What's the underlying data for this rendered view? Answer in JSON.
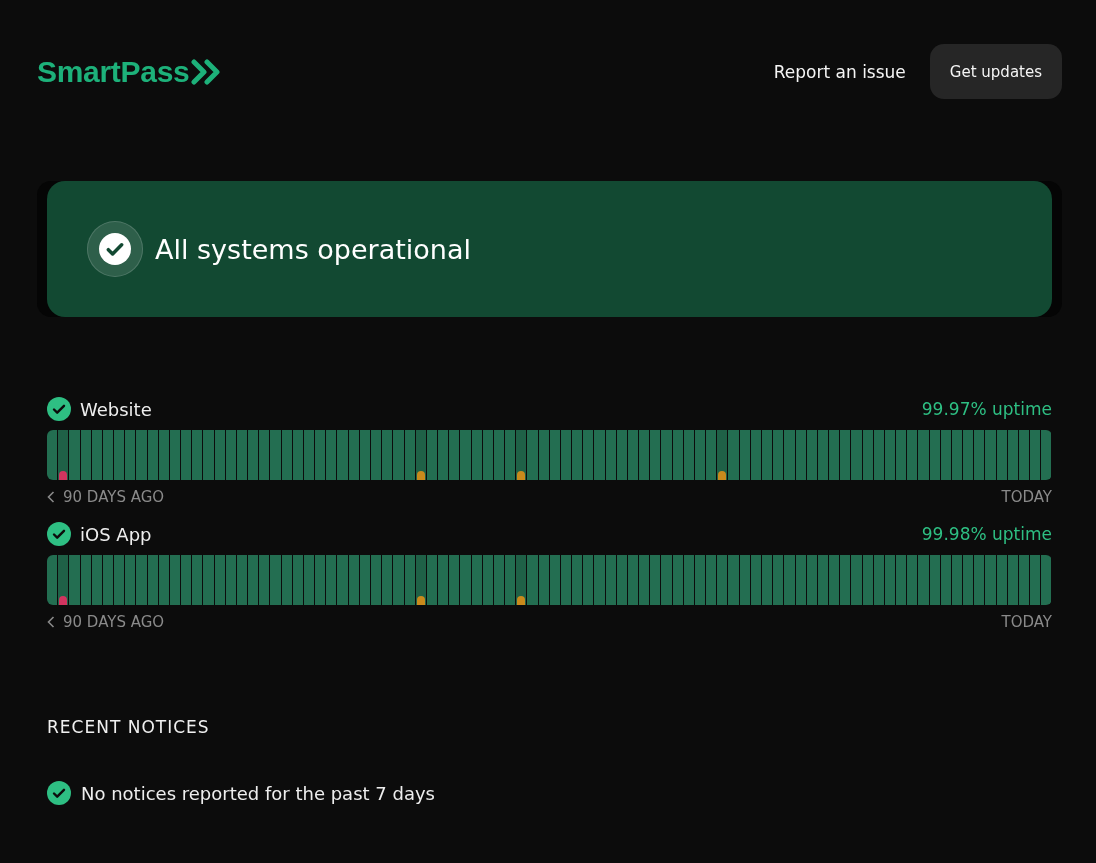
{
  "header": {
    "logo": "SmartPass",
    "links": [
      {
        "label": "Report an issue",
        "kind": "link"
      },
      {
        "label": "Get updates",
        "kind": "button"
      }
    ]
  },
  "banner": {
    "title": "All systems operational",
    "operational": true
  },
  "services": [
    {
      "name": "Website",
      "operational": true,
      "uptime": "99.97% uptime",
      "start_label": "90 DAYS AGO",
      "end_label": "TODAY",
      "days": [
        {
          "kind": "ok"
        },
        {
          "kind": "major"
        },
        {
          "kind": "ok"
        },
        {
          "kind": "ok"
        },
        {
          "kind": "ok"
        },
        {
          "kind": "ok"
        },
        {
          "kind": "ok"
        },
        {
          "kind": "ok"
        },
        {
          "kind": "ok"
        },
        {
          "kind": "ok"
        },
        {
          "kind": "ok"
        },
        {
          "kind": "ok"
        },
        {
          "kind": "ok"
        },
        {
          "kind": "ok"
        },
        {
          "kind": "ok"
        },
        {
          "kind": "ok"
        },
        {
          "kind": "ok"
        },
        {
          "kind": "ok"
        },
        {
          "kind": "ok"
        },
        {
          "kind": "ok"
        },
        {
          "kind": "ok"
        },
        {
          "kind": "ok"
        },
        {
          "kind": "ok"
        },
        {
          "kind": "ok"
        },
        {
          "kind": "ok"
        },
        {
          "kind": "ok"
        },
        {
          "kind": "ok"
        },
        {
          "kind": "ok"
        },
        {
          "kind": "ok"
        },
        {
          "kind": "ok"
        },
        {
          "kind": "ok"
        },
        {
          "kind": "ok"
        },
        {
          "kind": "ok"
        },
        {
          "kind": "minor"
        },
        {
          "kind": "ok"
        },
        {
          "kind": "ok"
        },
        {
          "kind": "ok"
        },
        {
          "kind": "ok"
        },
        {
          "kind": "ok"
        },
        {
          "kind": "ok"
        },
        {
          "kind": "ok"
        },
        {
          "kind": "ok"
        },
        {
          "kind": "minor"
        },
        {
          "kind": "ok"
        },
        {
          "kind": "ok"
        },
        {
          "kind": "ok"
        },
        {
          "kind": "ok"
        },
        {
          "kind": "ok"
        },
        {
          "kind": "ok"
        },
        {
          "kind": "ok"
        },
        {
          "kind": "ok"
        },
        {
          "kind": "ok"
        },
        {
          "kind": "ok"
        },
        {
          "kind": "ok"
        },
        {
          "kind": "ok"
        },
        {
          "kind": "ok"
        },
        {
          "kind": "ok"
        },
        {
          "kind": "ok"
        },
        {
          "kind": "ok"
        },
        {
          "kind": "ok"
        },
        {
          "kind": "minor"
        },
        {
          "kind": "ok"
        },
        {
          "kind": "ok"
        },
        {
          "kind": "ok"
        },
        {
          "kind": "ok"
        },
        {
          "kind": "ok"
        },
        {
          "kind": "ok"
        },
        {
          "kind": "ok"
        },
        {
          "kind": "ok"
        },
        {
          "kind": "ok"
        },
        {
          "kind": "ok"
        },
        {
          "kind": "ok"
        },
        {
          "kind": "ok"
        },
        {
          "kind": "ok"
        },
        {
          "kind": "ok"
        },
        {
          "kind": "ok"
        },
        {
          "kind": "ok"
        },
        {
          "kind": "ok"
        },
        {
          "kind": "ok"
        },
        {
          "kind": "ok"
        },
        {
          "kind": "ok"
        },
        {
          "kind": "ok"
        },
        {
          "kind": "ok"
        },
        {
          "kind": "ok"
        },
        {
          "kind": "ok"
        },
        {
          "kind": "ok"
        },
        {
          "kind": "ok"
        },
        {
          "kind": "ok"
        },
        {
          "kind": "ok"
        },
        {
          "kind": "ok"
        }
      ]
    },
    {
      "name": "iOS App",
      "operational": true,
      "uptime": "99.98% uptime",
      "start_label": "90 DAYS AGO",
      "end_label": "TODAY",
      "days": [
        {
          "kind": "ok"
        },
        {
          "kind": "major"
        },
        {
          "kind": "ok"
        },
        {
          "kind": "ok"
        },
        {
          "kind": "ok"
        },
        {
          "kind": "ok"
        },
        {
          "kind": "ok"
        },
        {
          "kind": "ok"
        },
        {
          "kind": "ok"
        },
        {
          "kind": "ok"
        },
        {
          "kind": "ok"
        },
        {
          "kind": "ok"
        },
        {
          "kind": "ok"
        },
        {
          "kind": "ok"
        },
        {
          "kind": "ok"
        },
        {
          "kind": "ok"
        },
        {
          "kind": "ok"
        },
        {
          "kind": "ok"
        },
        {
          "kind": "ok"
        },
        {
          "kind": "ok"
        },
        {
          "kind": "ok"
        },
        {
          "kind": "ok"
        },
        {
          "kind": "ok"
        },
        {
          "kind": "ok"
        },
        {
          "kind": "ok"
        },
        {
          "kind": "ok"
        },
        {
          "kind": "ok"
        },
        {
          "kind": "ok"
        },
        {
          "kind": "ok"
        },
        {
          "kind": "ok"
        },
        {
          "kind": "ok"
        },
        {
          "kind": "ok"
        },
        {
          "kind": "ok"
        },
        {
          "kind": "minor"
        },
        {
          "kind": "ok"
        },
        {
          "kind": "ok"
        },
        {
          "kind": "ok"
        },
        {
          "kind": "ok"
        },
        {
          "kind": "ok"
        },
        {
          "kind": "ok"
        },
        {
          "kind": "ok"
        },
        {
          "kind": "ok"
        },
        {
          "kind": "minor"
        },
        {
          "kind": "ok"
        },
        {
          "kind": "ok"
        },
        {
          "kind": "ok"
        },
        {
          "kind": "ok"
        },
        {
          "kind": "ok"
        },
        {
          "kind": "ok"
        },
        {
          "kind": "ok"
        },
        {
          "kind": "ok"
        },
        {
          "kind": "ok"
        },
        {
          "kind": "ok"
        },
        {
          "kind": "ok"
        },
        {
          "kind": "ok"
        },
        {
          "kind": "ok"
        },
        {
          "kind": "ok"
        },
        {
          "kind": "ok"
        },
        {
          "kind": "ok"
        },
        {
          "kind": "ok"
        },
        {
          "kind": "ok"
        },
        {
          "kind": "ok"
        },
        {
          "kind": "ok"
        },
        {
          "kind": "ok"
        },
        {
          "kind": "ok"
        },
        {
          "kind": "ok"
        },
        {
          "kind": "ok"
        },
        {
          "kind": "ok"
        },
        {
          "kind": "ok"
        },
        {
          "kind": "ok"
        },
        {
          "kind": "ok"
        },
        {
          "kind": "ok"
        },
        {
          "kind": "ok"
        },
        {
          "kind": "ok"
        },
        {
          "kind": "ok"
        },
        {
          "kind": "ok"
        },
        {
          "kind": "ok"
        },
        {
          "kind": "ok"
        },
        {
          "kind": "ok"
        },
        {
          "kind": "ok"
        },
        {
          "kind": "ok"
        },
        {
          "kind": "ok"
        },
        {
          "kind": "ok"
        },
        {
          "kind": "ok"
        },
        {
          "kind": "ok"
        },
        {
          "kind": "ok"
        },
        {
          "kind": "ok"
        },
        {
          "kind": "ok"
        },
        {
          "kind": "ok"
        },
        {
          "kind": "ok"
        }
      ]
    }
  ],
  "notices": {
    "heading": "RECENT NOTICES",
    "items": [
      {
        "text": "No notices reported for the past 7 days",
        "operational": true
      }
    ]
  }
}
